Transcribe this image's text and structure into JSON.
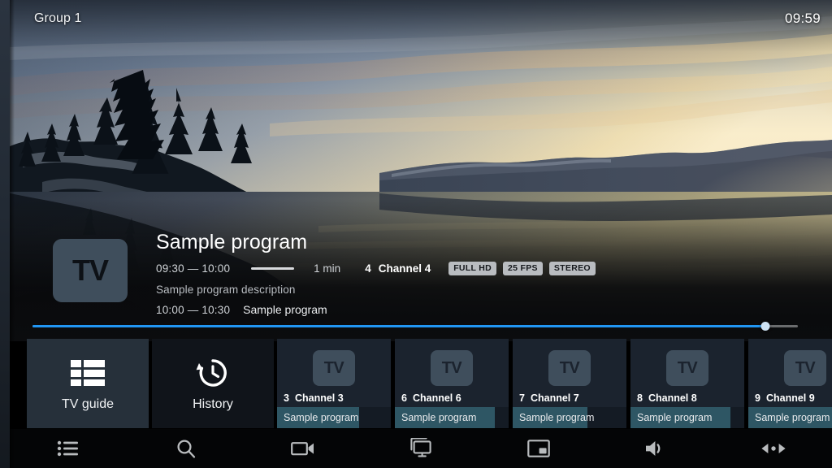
{
  "topbar": {
    "group_label": "Group 1",
    "clock": "09:59"
  },
  "program": {
    "logo_text": "TV",
    "title": "Sample program",
    "time_range": "09:30 — 10:00",
    "duration": "1 min",
    "channel_number": "4",
    "channel_name": "Channel 4",
    "badges": [
      "FULL HD",
      "25 FPS",
      "STEREO"
    ],
    "description": "Sample program description",
    "next_time": "10:00 — 10:30",
    "next_title": "Sample program"
  },
  "seek": {
    "progress_percent": 95.8,
    "fill_color": "#2196f3",
    "track_color": "#6a6c6e",
    "thumb_color": "#cfe3f5"
  },
  "tiles": {
    "tv_guide": {
      "label": "TV guide",
      "icon": "guide-grid-icon",
      "selected": true
    },
    "history": {
      "label": "History",
      "icon": "history-clock-icon",
      "selected": false
    }
  },
  "channels": [
    {
      "number": "3",
      "name": "Channel 3",
      "logo_text": "TV",
      "program": "Sample program",
      "progress_percent": 72
    },
    {
      "number": "6",
      "name": "Channel 6",
      "logo_text": "TV",
      "program": "Sample program",
      "progress_percent": 88
    },
    {
      "number": "7",
      "name": "Channel 7",
      "logo_text": "TV",
      "program": "Sample program",
      "progress_percent": 66
    },
    {
      "number": "8",
      "name": "Channel 8",
      "logo_text": "TV",
      "program": "Sample program",
      "progress_percent": 88
    },
    {
      "number": "9",
      "name": "Channel 9",
      "logo_text": "TV",
      "program": "Sample program",
      "progress_percent": 88
    }
  ],
  "toolbar": {
    "buttons": [
      {
        "icon": "list-icon",
        "name": "channel-list-button"
      },
      {
        "icon": "search-icon",
        "name": "search-button"
      },
      {
        "icon": "videocam-icon",
        "name": "record-button"
      },
      {
        "icon": "cast-display-icon",
        "name": "cast-button"
      },
      {
        "icon": "picture-in-picture-icon",
        "name": "pip-button"
      },
      {
        "icon": "volume-icon",
        "name": "volume-button"
      },
      {
        "icon": "audio-track-icon",
        "name": "audio-track-button"
      }
    ]
  },
  "colors": {
    "accent_blue": "#2196f3",
    "tile_selected": "#26303a",
    "card_bg": "#1b232e",
    "logo_bg": "#3f4e5c",
    "progress_teal": "#2e5664",
    "badge_bg": "#b9bcc0"
  }
}
